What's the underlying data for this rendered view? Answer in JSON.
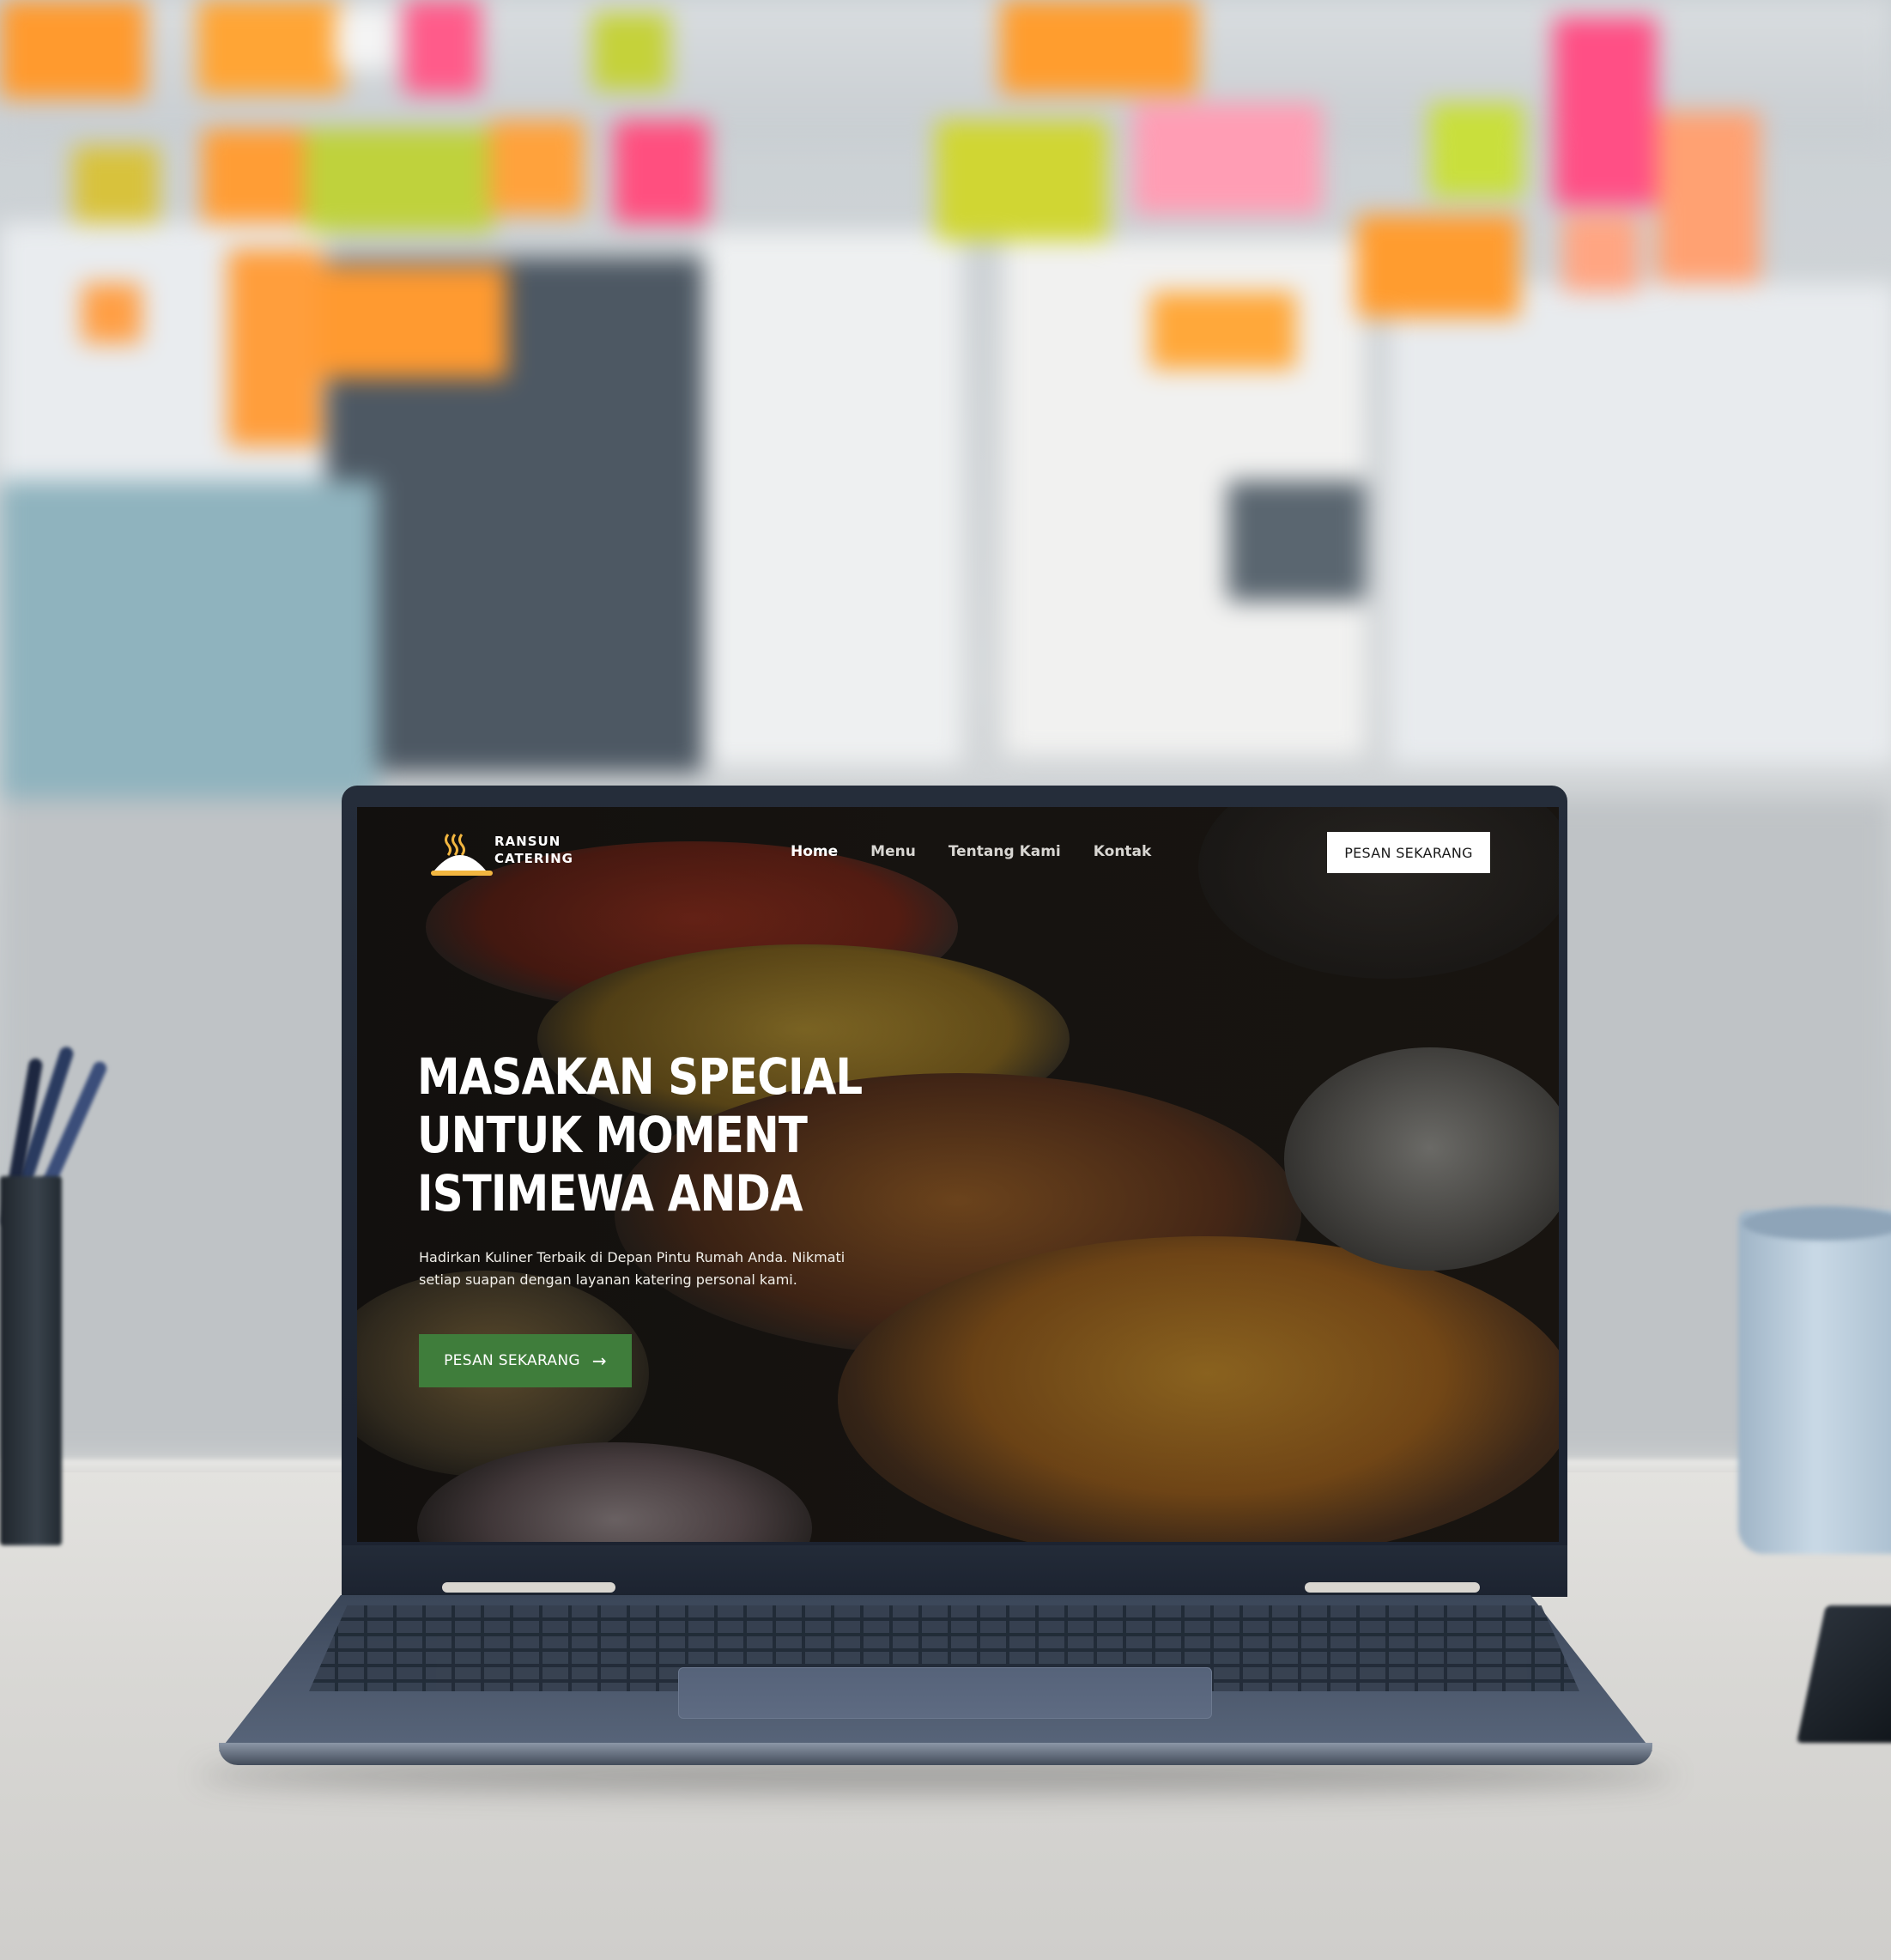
{
  "site": {
    "logo": {
      "line1": "RANSUN",
      "line2": "CATERING",
      "icon": "serving-cloche-icon"
    },
    "nav": {
      "links": [
        {
          "label": "Home",
          "active": true
        },
        {
          "label": "Menu",
          "active": false
        },
        {
          "label": "Tentang Kami",
          "active": false
        },
        {
          "label": "Kontak",
          "active": false
        }
      ],
      "cta_label": "PESAN SEKARANG"
    },
    "hero": {
      "title_lines": [
        "MASAKAN SPECIAL",
        "UNTUK MOMENT",
        "ISTIMEWA ANDA"
      ],
      "subtitle": "Hadirkan Kuliner Terbaik di Depan Pintu Rumah Anda. Nikmati setiap suapan dengan layanan katering personal kami.",
      "cta_label": "PESAN SEKARANG",
      "cta_icon": "arrow-right-icon"
    },
    "colors": {
      "primary_green": "#3f7d3b",
      "logo_gold": "#f2b640",
      "nav_cta_bg": "#ffffff"
    }
  }
}
